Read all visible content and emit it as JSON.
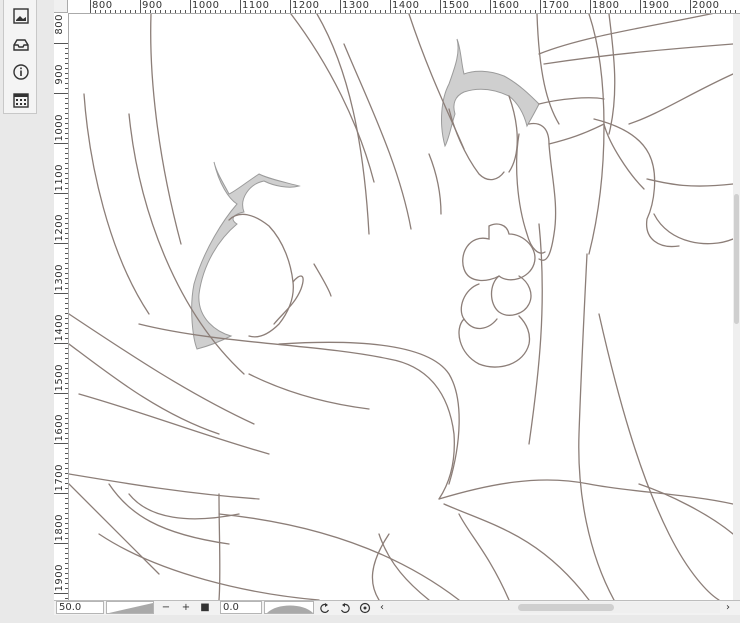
{
  "tool_palette": {
    "items": [
      {
        "icon": "layer-thumbnail-icon"
      },
      {
        "icon": "tray-icon"
      },
      {
        "icon": "info-icon"
      },
      {
        "icon": "calendar-grid-icon"
      }
    ]
  },
  "rulers": {
    "horizontal": [
      "800",
      "900",
      "1000",
      "1100",
      "1200",
      "1300",
      "1400",
      "1500",
      "1600",
      "1700",
      "1800",
      "1900",
      "2000"
    ],
    "vertical": [
      "800",
      "900",
      "1000",
      "1100",
      "1200",
      "1300",
      "1400",
      "1500",
      "1600",
      "1700",
      "1800",
      "1900"
    ]
  },
  "status_bar": {
    "zoom_value": "50.0",
    "zoom_out_label": "−",
    "zoom_in_label": "+",
    "stop_label": "■",
    "rotation_value": "0.0",
    "undo_icon": "rotate-left-icon",
    "redo_icon": "rotate-right-icon",
    "reset_icon": "reset-rotation-icon",
    "scroll_left_label": "‹",
    "scroll_right_label": "›"
  },
  "colors": {
    "line_art": "#8c7e78",
    "fill_gray": "#cfcfcf",
    "canvas": "#ffffff",
    "panel": "#f4f4f4"
  }
}
